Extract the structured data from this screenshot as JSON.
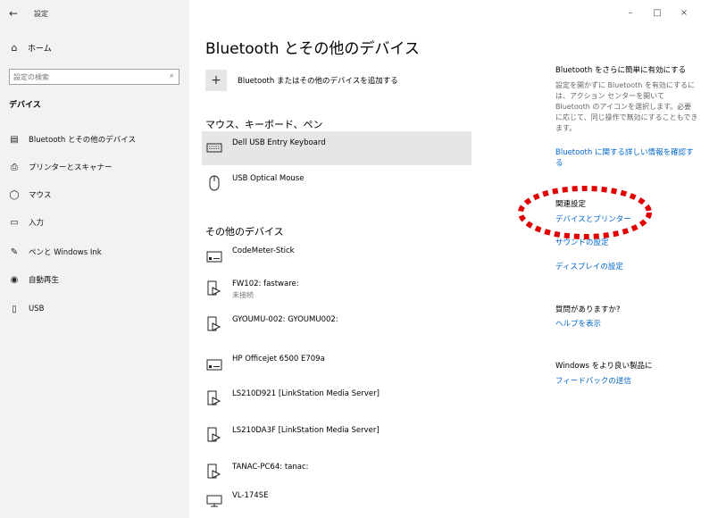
{
  "sidebar": {
    "back": "←",
    "title": "設定",
    "home": "ホーム",
    "search_placeholder": "設定の検索",
    "section": "デバイス",
    "items": [
      {
        "label": "Bluetooth とその他のデバイス",
        "icon": "bluetooth-devices-icon"
      },
      {
        "label": "プリンターとスキャナー",
        "icon": "printer-icon"
      },
      {
        "label": "マウス",
        "icon": "mouse-icon"
      },
      {
        "label": "入力",
        "icon": "keyboard-icon"
      },
      {
        "label": "ペンと Windows Ink",
        "icon": "pen-icon"
      },
      {
        "label": "自動再生",
        "icon": "autoplay-icon"
      },
      {
        "label": "USB",
        "icon": "usb-icon"
      }
    ]
  },
  "window": {
    "minimize": "–",
    "maximize": "□",
    "close": "×"
  },
  "main": {
    "title": "Bluetooth とその他のデバイス",
    "add_label": "Bluetooth またはその他のデバイスを追加する",
    "input_section": "マウス、キーボード、ペン",
    "input_devices": [
      {
        "name": "Dell USB Entry Keyboard",
        "icon": "keyboard-icon"
      },
      {
        "name": "USB Optical Mouse",
        "icon": "mouse-icon"
      }
    ],
    "other_section": "その他のデバイス",
    "other_devices": [
      {
        "name": "CodeMeter-Stick",
        "sub": "",
        "icon": "drive-icon"
      },
      {
        "name": "FW102: fastware:",
        "sub": "未接続",
        "icon": "media-device-icon"
      },
      {
        "name": "GYOUMU-002: GYOUMU002:",
        "sub": "",
        "icon": "media-device-icon"
      },
      {
        "name": "HP Officejet 6500 E709a",
        "sub": "",
        "icon": "drive-icon"
      },
      {
        "name": "LS210D921 [LinkStation Media Server]",
        "sub": "",
        "icon": "media-device-icon"
      },
      {
        "name": "LS210DA3F [LinkStation Media Server]",
        "sub": "",
        "icon": "media-device-icon"
      },
      {
        "name": "TANAC-PC64: tanac:",
        "sub": "",
        "icon": "media-device-icon"
      },
      {
        "name": "VL-174SE",
        "sub": "",
        "icon": "monitor-icon"
      }
    ]
  },
  "right": {
    "bt_head": "Bluetooth をさらに簡単に有効にする",
    "bt_text": "設定を開かずに Bluetooth を有効にするには、アクション センターを開いて Bluetooth のアイコンを選択します。必要に応じて、同じ操作で無効にすることもできます。",
    "bt_link": "Bluetooth に関する詳しい情報を確認する",
    "related_head": "関連設定",
    "related_links": [
      "デバイスとプリンター",
      "サウンドの設定",
      "ディスプレイの設定"
    ],
    "question_head": "質問がありますか?",
    "question_link": "ヘルプを表示",
    "better_head": "Windows をより良い製品に",
    "better_link": "フィードバックの送信"
  },
  "colors": {
    "link": "#0066cc",
    "highlight": "#e00000",
    "sidebar": "#f2f2f2"
  }
}
